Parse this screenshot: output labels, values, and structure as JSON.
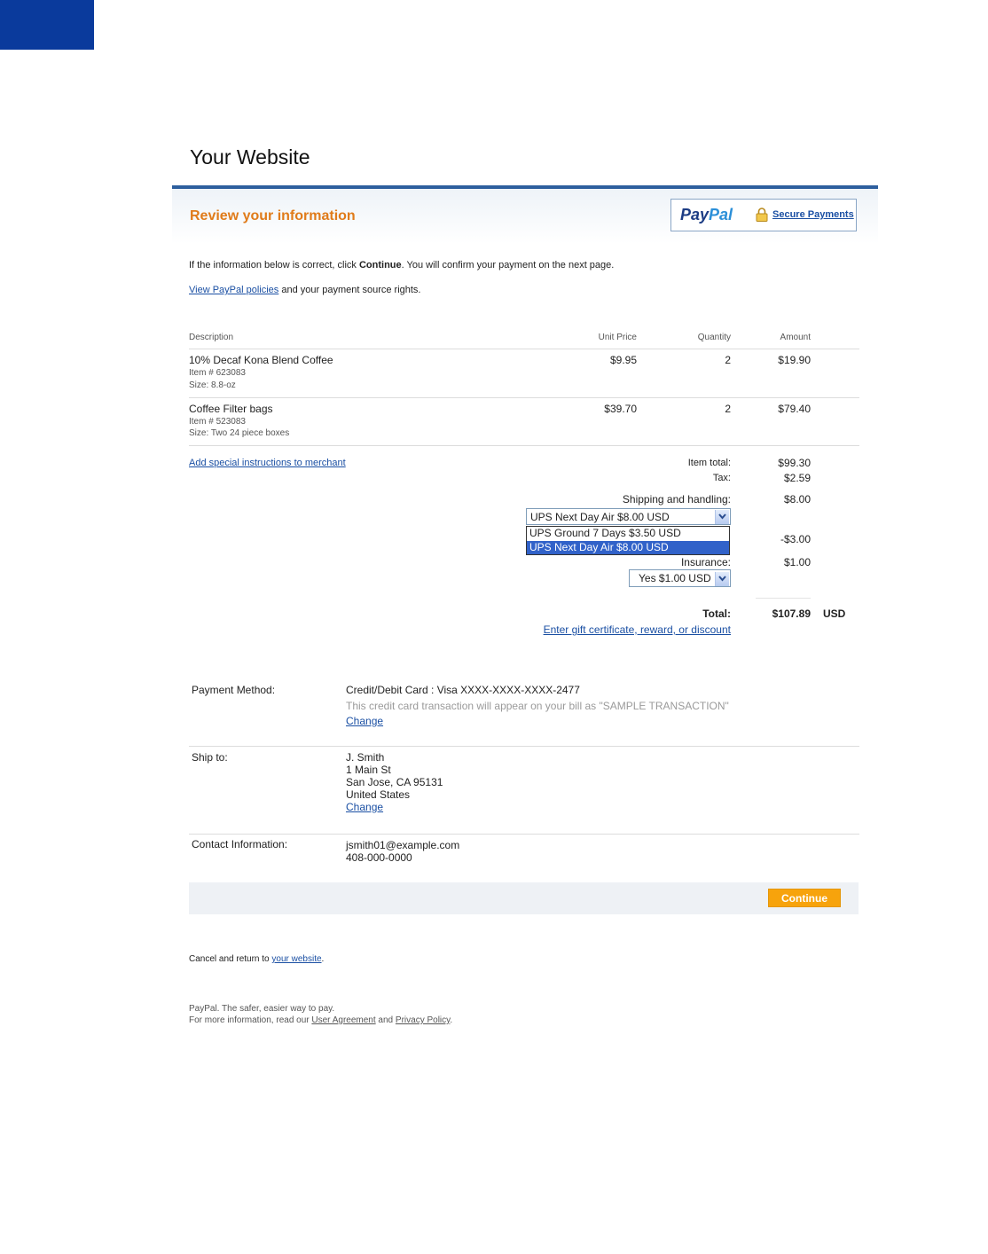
{
  "site": {
    "title": "Your Website"
  },
  "header": {
    "review_title": "Review your information",
    "paypal_logo_a": "Pay",
    "paypal_logo_b": "Pal",
    "secure_payments": "Secure Payments"
  },
  "intro": {
    "line1_pre": "If the information below is correct, click ",
    "line1_bold": "Continue",
    "line1_post": ". You will confirm your payment on the next page.",
    "policies_link": "View PayPal policies",
    "policies_post": " and your payment source rights."
  },
  "table": {
    "headers": {
      "description": "Description",
      "unit_price": "Unit Price",
      "quantity": "Quantity",
      "amount": "Amount"
    },
    "items": [
      {
        "name": "10% Decaf Kona Blend Coffee",
        "item_no": "Item # 623083",
        "size": "Size: 8.8-oz",
        "unit_price": "$9.95",
        "quantity": "2",
        "amount": "$19.90"
      },
      {
        "name": "Coffee Filter bags",
        "item_no": "Item # 523083",
        "size": "Size: Two 24 piece boxes",
        "unit_price": "$39.70",
        "quantity": "2",
        "amount": "$79.40"
      }
    ]
  },
  "summary": {
    "special_instructions_link": "Add special instructions to merchant",
    "item_total_label": "Item total:",
    "item_total": "$99.30",
    "tax_label": "Tax:",
    "tax": "$2.59",
    "shipping_label": "Shipping and handling:",
    "shipping": "$8.00",
    "shipping_selected": "UPS Next Day Air  $8.00 USD",
    "shipping_options": [
      "UPS Ground 7 Days  $3.50 USD",
      "UPS Next Day Air  $8.00 USD"
    ],
    "discount": "-$3.00",
    "insurance_label": "Insurance:",
    "insurance": "$1.00",
    "insurance_selected": "Yes $1.00 USD",
    "total_label": "Total:",
    "total": "$107.89",
    "currency": "USD",
    "gift_link": "Enter gift certificate, reward, or discount"
  },
  "details": {
    "payment_label": "Payment Method:",
    "payment_value": "Credit/Debit Card : Visa XXXX-XXXX-XXXX-2477",
    "payment_note": "This credit card transaction will appear on your bill as \"SAMPLE TRANSACTION\"",
    "change_label": "Change",
    "ship_label": "Ship to:",
    "ship_lines": [
      "J. Smith",
      "1 Main St",
      "San Jose, CA 95131",
      "United States"
    ],
    "contact_label": "Contact Information:",
    "contact_email": "jsmith01@example.com",
    "contact_phone": "408-000-0000"
  },
  "actions": {
    "continue": "Continue"
  },
  "footer": {
    "cancel_pre": "Cancel and return to ",
    "cancel_link": "your website",
    "cancel_post": ".",
    "tagline": "PayPal. The safer, easier way to pay.",
    "info_pre": "For more information, read our ",
    "user_agreement": "User Agreement",
    "and": " and ",
    "privacy": "Privacy Policy",
    "info_post": "."
  },
  "colors": {
    "accent_orange": "#e07b1a",
    "brand_blue": "#2d5f9e",
    "corner_blue": "#0a3a9c",
    "button_orange": "#f7a30c"
  }
}
